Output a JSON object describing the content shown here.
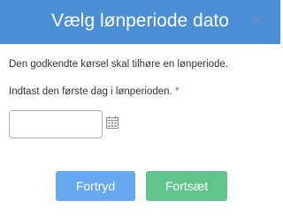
{
  "dialog": {
    "title": "Vælg lønperiode dato",
    "close_label": "×",
    "description": "Den godkendte kørsel skal tilhøre en lønperiode.",
    "date_label": "Indtast den første dag i lønperioden.",
    "required_marker": "*",
    "date_value": "",
    "cancel_label": "Fortryd",
    "continue_label": "Fortsæt"
  },
  "colors": {
    "header": "#4a8fd6",
    "cancel_button": "#67a8f2",
    "continue_button": "#61c48a",
    "required": "#d9363e"
  },
  "icons": {
    "close": "close-icon",
    "calendar": "calendar-icon"
  }
}
